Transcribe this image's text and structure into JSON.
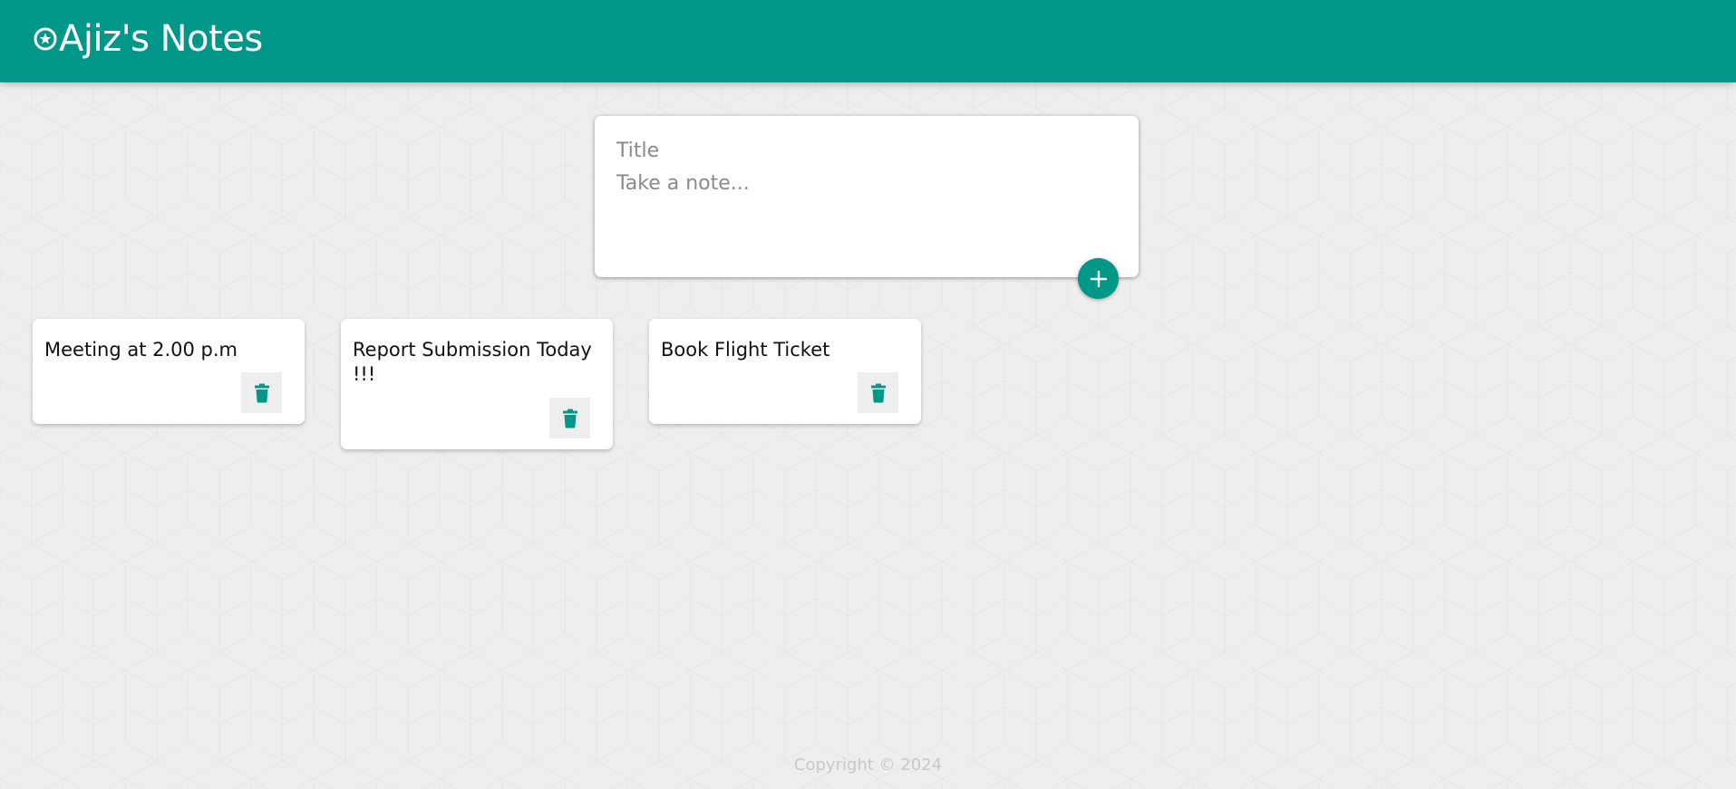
{
  "app": {
    "title": "Ajiz's Notes",
    "brand_icon": "star-circle-icon",
    "accent_color": "#009688",
    "background_color": "#eeeeee"
  },
  "create_note": {
    "title_placeholder": "Title",
    "content_placeholder": "Take a note...",
    "title_value": "",
    "content_value": "",
    "add_icon": "plus-icon"
  },
  "notes": [
    {
      "text": "Meeting at 2.00 p.m",
      "delete_icon": "trash-icon"
    },
    {
      "text": "Report Submission Today !!!",
      "delete_icon": "trash-icon"
    },
    {
      "text": "Book Flight Ticket",
      "delete_icon": "trash-icon"
    }
  ],
  "footer": {
    "copyright": "Copyright © 2024"
  }
}
